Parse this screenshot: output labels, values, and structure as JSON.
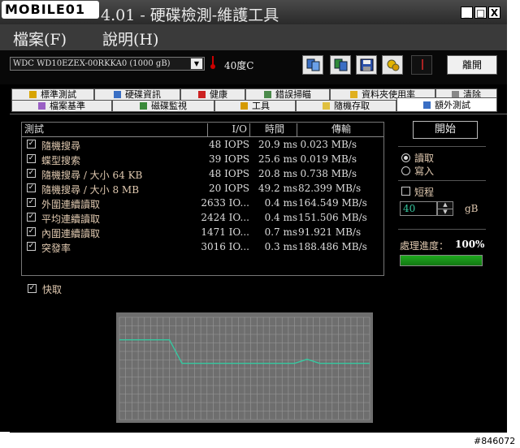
{
  "watermark": "MOBILE01",
  "window": {
    "title": "HD Tune Pro 4.01 - 硬碟檢測-維護工具",
    "title_visible": "4.01 - 硬碟檢測-維護工具",
    "minimize": "_",
    "maximize": "□",
    "close": "X"
  },
  "menu": {
    "items": [
      "檔案(F)",
      "說明(H)"
    ]
  },
  "toolbar": {
    "drive": "WDC WD10EZEX-00RKKA0 (1000 gB)",
    "temperature": "40度C",
    "exit_label": "離開",
    "icons": [
      "copy-info-icon",
      "copy-screenshot-icon",
      "save-icon",
      "options-icon",
      "disabled-icon"
    ]
  },
  "tabs": {
    "row1": [
      "標準測試",
      "硬碟資訊",
      "健康",
      "錯誤掃瞄",
      "資料夾使用率",
      "清除"
    ],
    "row2": [
      "檔案基準",
      "磁碟監視",
      "工具",
      "隨機存取",
      "額外測試"
    ],
    "active": "額外測試"
  },
  "grid": {
    "headers": {
      "test": "測試",
      "io": "I/O",
      "time": "時間",
      "transfer": "傳輸"
    },
    "rows": [
      {
        "checked": true,
        "test": "隨機搜尋",
        "io": "48 IOPS",
        "time": "20.9 ms",
        "transfer": "0.023 MB/s"
      },
      {
        "checked": true,
        "test": "蝶型搜索",
        "io": "39 IOPS",
        "time": "25.6 ms",
        "transfer": "0.019 MB/s"
      },
      {
        "checked": true,
        "test": "隨機搜尋 / 大小 64 KB",
        "io": "48 IOPS",
        "time": "20.8 ms",
        "transfer": "0.738 MB/s"
      },
      {
        "checked": true,
        "test": "隨機搜尋 / 大小 8 MB",
        "io": "20 IOPS",
        "time": "49.2 ms",
        "transfer": "82.399 MB/s"
      },
      {
        "checked": true,
        "test": "外圍連續讀取",
        "io": "2633 IO...",
        "time": "0.4 ms",
        "transfer": "164.549 MB/s"
      },
      {
        "checked": true,
        "test": "平均連續讀取",
        "io": "2424 IO...",
        "time": "0.4 ms",
        "transfer": "151.506 MB/s"
      },
      {
        "checked": true,
        "test": "內圍連續讀取",
        "io": "1471 IO...",
        "time": "0.7 ms",
        "transfer": "91.921 MB/s"
      },
      {
        "checked": true,
        "test": "突發率",
        "io": "3016 IO...",
        "time": "0.3 ms",
        "transfer": "188.486 MB/s"
      }
    ]
  },
  "side": {
    "start_label": "開始",
    "read_label": "讀取",
    "write_label": "寫入",
    "mode": "read",
    "short_label": "短程",
    "short_checked": false,
    "size_value": "40",
    "size_unit": "gB",
    "progress_label": "處理進度：",
    "progress_value": "100%",
    "progress_fraction": 1.0
  },
  "cache": {
    "label": "快取",
    "checked": true
  },
  "colors": {
    "accent": "#35c8a0",
    "progress": "#1fa81f",
    "label_text": "#e0c9b0"
  },
  "chart_data": {
    "type": "line",
    "title": "",
    "xlabel": "",
    "ylabel": "",
    "grid": true,
    "x": [
      0,
      5,
      10,
      15,
      20,
      25,
      30,
      35,
      40,
      45,
      50,
      55,
      60,
      65,
      70,
      75,
      80,
      85,
      90,
      95,
      100
    ],
    "series": [
      {
        "values": [
          0.78,
          0.78,
          0.78,
          0.78,
          0.78,
          0.55,
          0.55,
          0.55,
          0.55,
          0.55,
          0.55,
          0.55,
          0.55,
          0.55,
          0.55,
          0.59,
          0.55,
          0.55,
          0.55,
          0.55,
          0.55
        ]
      }
    ],
    "ylim": [
      0,
      1
    ]
  },
  "footer_id": "#846072"
}
